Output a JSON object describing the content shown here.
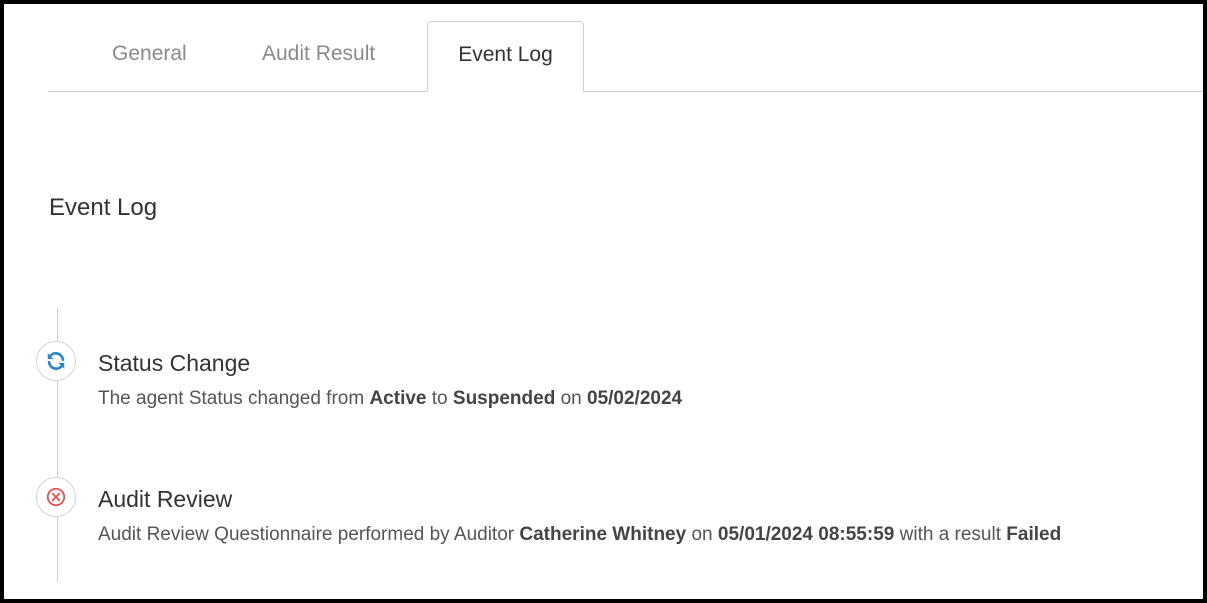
{
  "tabs": [
    {
      "label": "General",
      "active": false
    },
    {
      "label": "Audit Result",
      "active": false
    },
    {
      "label": "Event Log",
      "active": true
    }
  ],
  "section_title": "Event Log",
  "events": [
    {
      "icon": "refresh-icon",
      "icon_color": "#2a86c9",
      "title": "Status Change",
      "desc_parts": [
        "The agent Status changed from ",
        "Active",
        " to ",
        "Suspended",
        " on ",
        "05/02/2024"
      ]
    },
    {
      "icon": "x-circle-icon",
      "icon_color": "#e05555",
      "title": "Audit Review",
      "desc_parts": [
        "Audit Review Questionnaire performed by Auditor ",
        "Catherine Whitney",
        " on ",
        "05/01/2024 08:55:59",
        " with a result ",
        "Failed"
      ]
    }
  ]
}
